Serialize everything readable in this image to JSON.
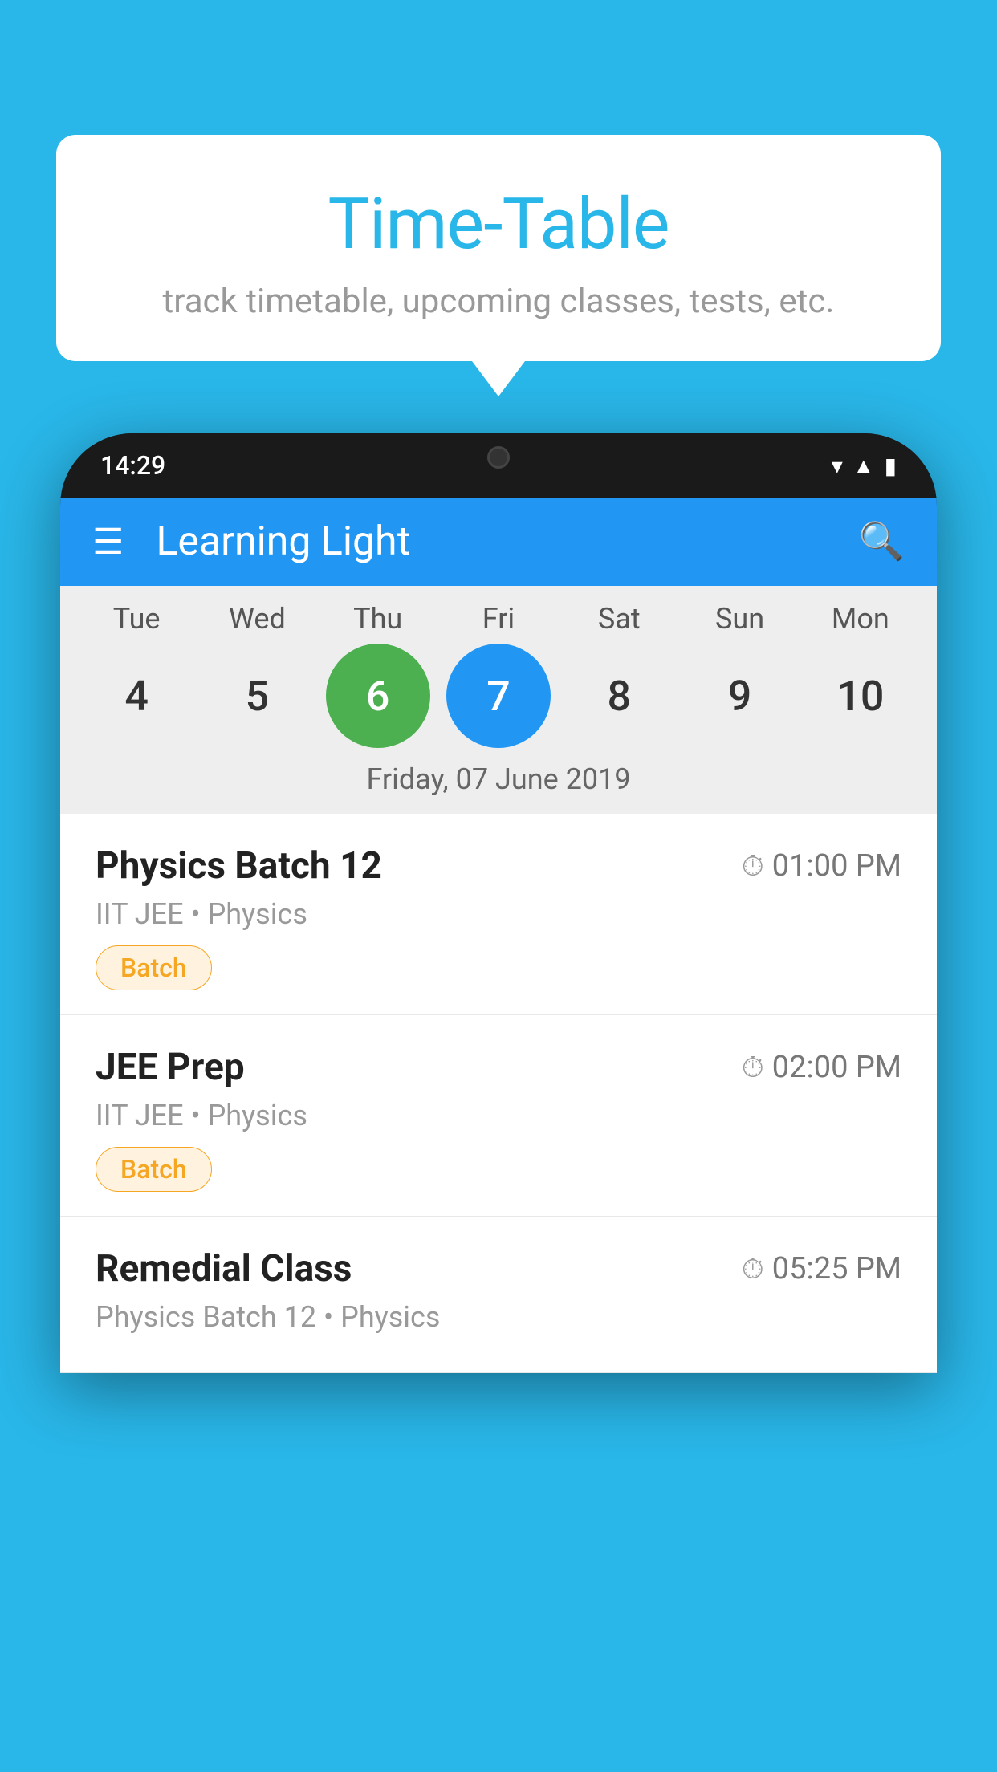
{
  "background_color": "#29b6e8",
  "tooltip": {
    "title": "Time-Table",
    "subtitle": "track timetable, upcoming classes, tests, etc."
  },
  "phone": {
    "status_time": "14:29",
    "app_name": "Learning Light",
    "calendar": {
      "days": [
        {
          "label": "Tue",
          "num": "4"
        },
        {
          "label": "Wed",
          "num": "5"
        },
        {
          "label": "Thu",
          "num": "6",
          "state": "today"
        },
        {
          "label": "Fri",
          "num": "7",
          "state": "selected"
        },
        {
          "label": "Sat",
          "num": "8"
        },
        {
          "label": "Sun",
          "num": "9"
        },
        {
          "label": "Mon",
          "num": "10"
        }
      ],
      "selected_date": "Friday, 07 June 2019"
    },
    "schedule": [
      {
        "title": "Physics Batch 12",
        "time": "01:00 PM",
        "subtitle": "IIT JEE • Physics",
        "tag": "Batch"
      },
      {
        "title": "JEE Prep",
        "time": "02:00 PM",
        "subtitle": "IIT JEE • Physics",
        "tag": "Batch"
      },
      {
        "title": "Remedial Class",
        "time": "05:25 PM",
        "subtitle": "Physics Batch 12 • Physics",
        "tag": ""
      }
    ]
  }
}
